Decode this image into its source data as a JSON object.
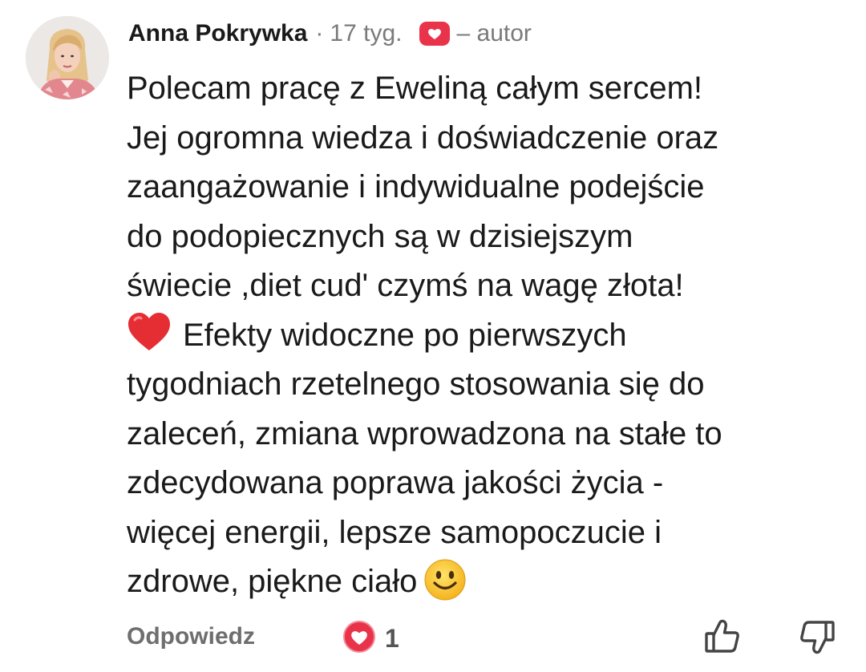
{
  "comment": {
    "author": "Anna Pokrywka",
    "separator": "·",
    "time": "17 tyg.",
    "author_tag": "– autor",
    "lines_before_heart": "Polecam pracę z Eweliną całym sercem!\nJej ogromna wiedza i doświadczenie oraz\nzaangażowanie i indywidualne podejście\ndo podopiecznych są w dzisiejszym\nświecie ,diet cud' czymś na wagę złota!\n",
    "lines_after_heart": "Efekty widoczne po pierwszych\ntygodniach rzetelnego stosowania się do\nzaleceń, zmiana wprowadzona na stałe to\nzdecydowana poprawa jakości życia -\nwięcej energii, lepsze samopoczucie i\nzdrowe, piękne ciało",
    "emojis": [
      "red-heart-emoji",
      "smiling-face-emoji"
    ]
  },
  "footer": {
    "reply_label": "Odpowiedz",
    "like_count": "1",
    "icons": [
      "heart-icon",
      "thumbs-up-icon",
      "thumbs-down-icon"
    ]
  },
  "colors": {
    "heart_red": "#e8334a",
    "muted_text": "#7a7a7a",
    "text": "#1a1a1a"
  }
}
